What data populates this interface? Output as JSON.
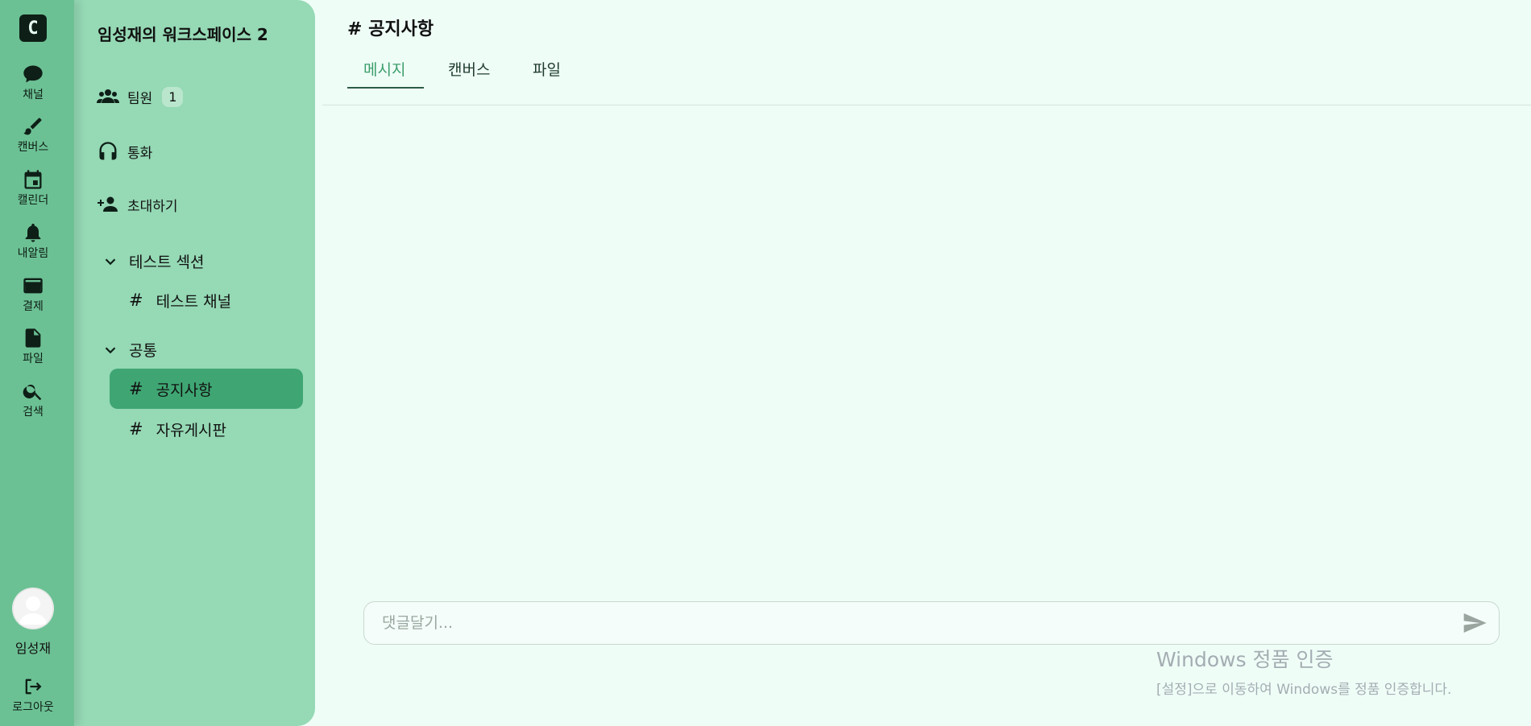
{
  "rail": {
    "logo": "C",
    "items": [
      {
        "label": "채널",
        "icon": "chat-icon"
      },
      {
        "label": "캔버스",
        "icon": "brush-icon"
      },
      {
        "label": "캘린더",
        "icon": "calendar-icon"
      },
      {
        "label": "내알림",
        "icon": "bell-icon"
      },
      {
        "label": "결제",
        "icon": "credit-card-icon"
      },
      {
        "label": "파일",
        "icon": "file-icon"
      },
      {
        "label": "검색",
        "icon": "search-icon"
      }
    ],
    "user_name": "임성재",
    "logout_label": "로그아웃"
  },
  "sidebar": {
    "workspace_title": "임성재의 워크스페이스 2",
    "members_label": "팀원",
    "members_count": "1",
    "call_label": "통화",
    "invite_label": "초대하기",
    "sections": [
      {
        "label": "테스트 섹션",
        "channels": [
          "테스트 채널"
        ]
      },
      {
        "label": "공통",
        "channels": [
          "공지사항",
          "자유게시판"
        ]
      }
    ],
    "hash": "#",
    "active_channel": "공지사항"
  },
  "main": {
    "title": "# 공지사항",
    "tabs": [
      "메시지",
      "캔버스",
      "파일"
    ],
    "active_tab": "메시지",
    "comment_placeholder": "댓글달기..."
  },
  "watermark": {
    "title": "Windows 정품 인증",
    "subtitle": "[설정]으로 이동하여 Windows를 정품 인증합니다."
  },
  "colors": {
    "rail_bg": "#6cc194",
    "sidebar_bg": "#95d9b5",
    "active_channel_bg": "#3fa673",
    "main_bg": "#effdf7",
    "accent": "#3c9d6a"
  }
}
